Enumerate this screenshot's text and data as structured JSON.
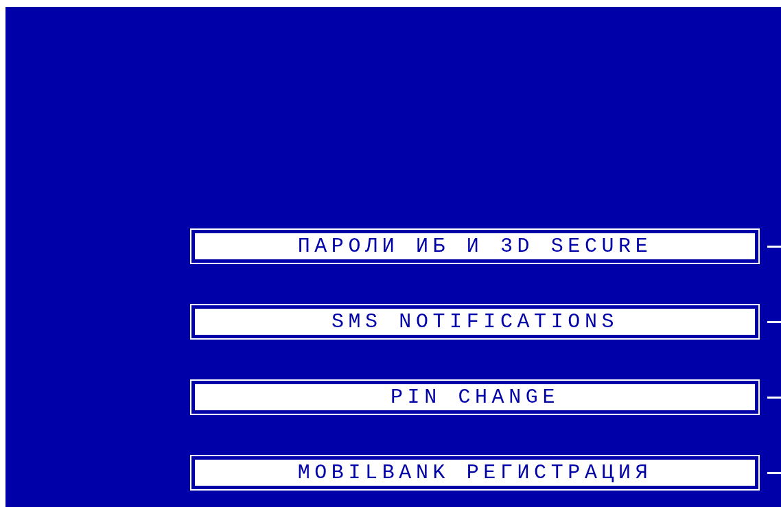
{
  "menu": [
    {
      "label": "ПАРОЛИ ИБ И 3D SECURE"
    },
    {
      "label": "SMS NOTIFICATIONS"
    },
    {
      "label": "PIN CHANGE"
    },
    {
      "label": "MOBILBANK РЕГИСТРАЦИЯ"
    }
  ]
}
